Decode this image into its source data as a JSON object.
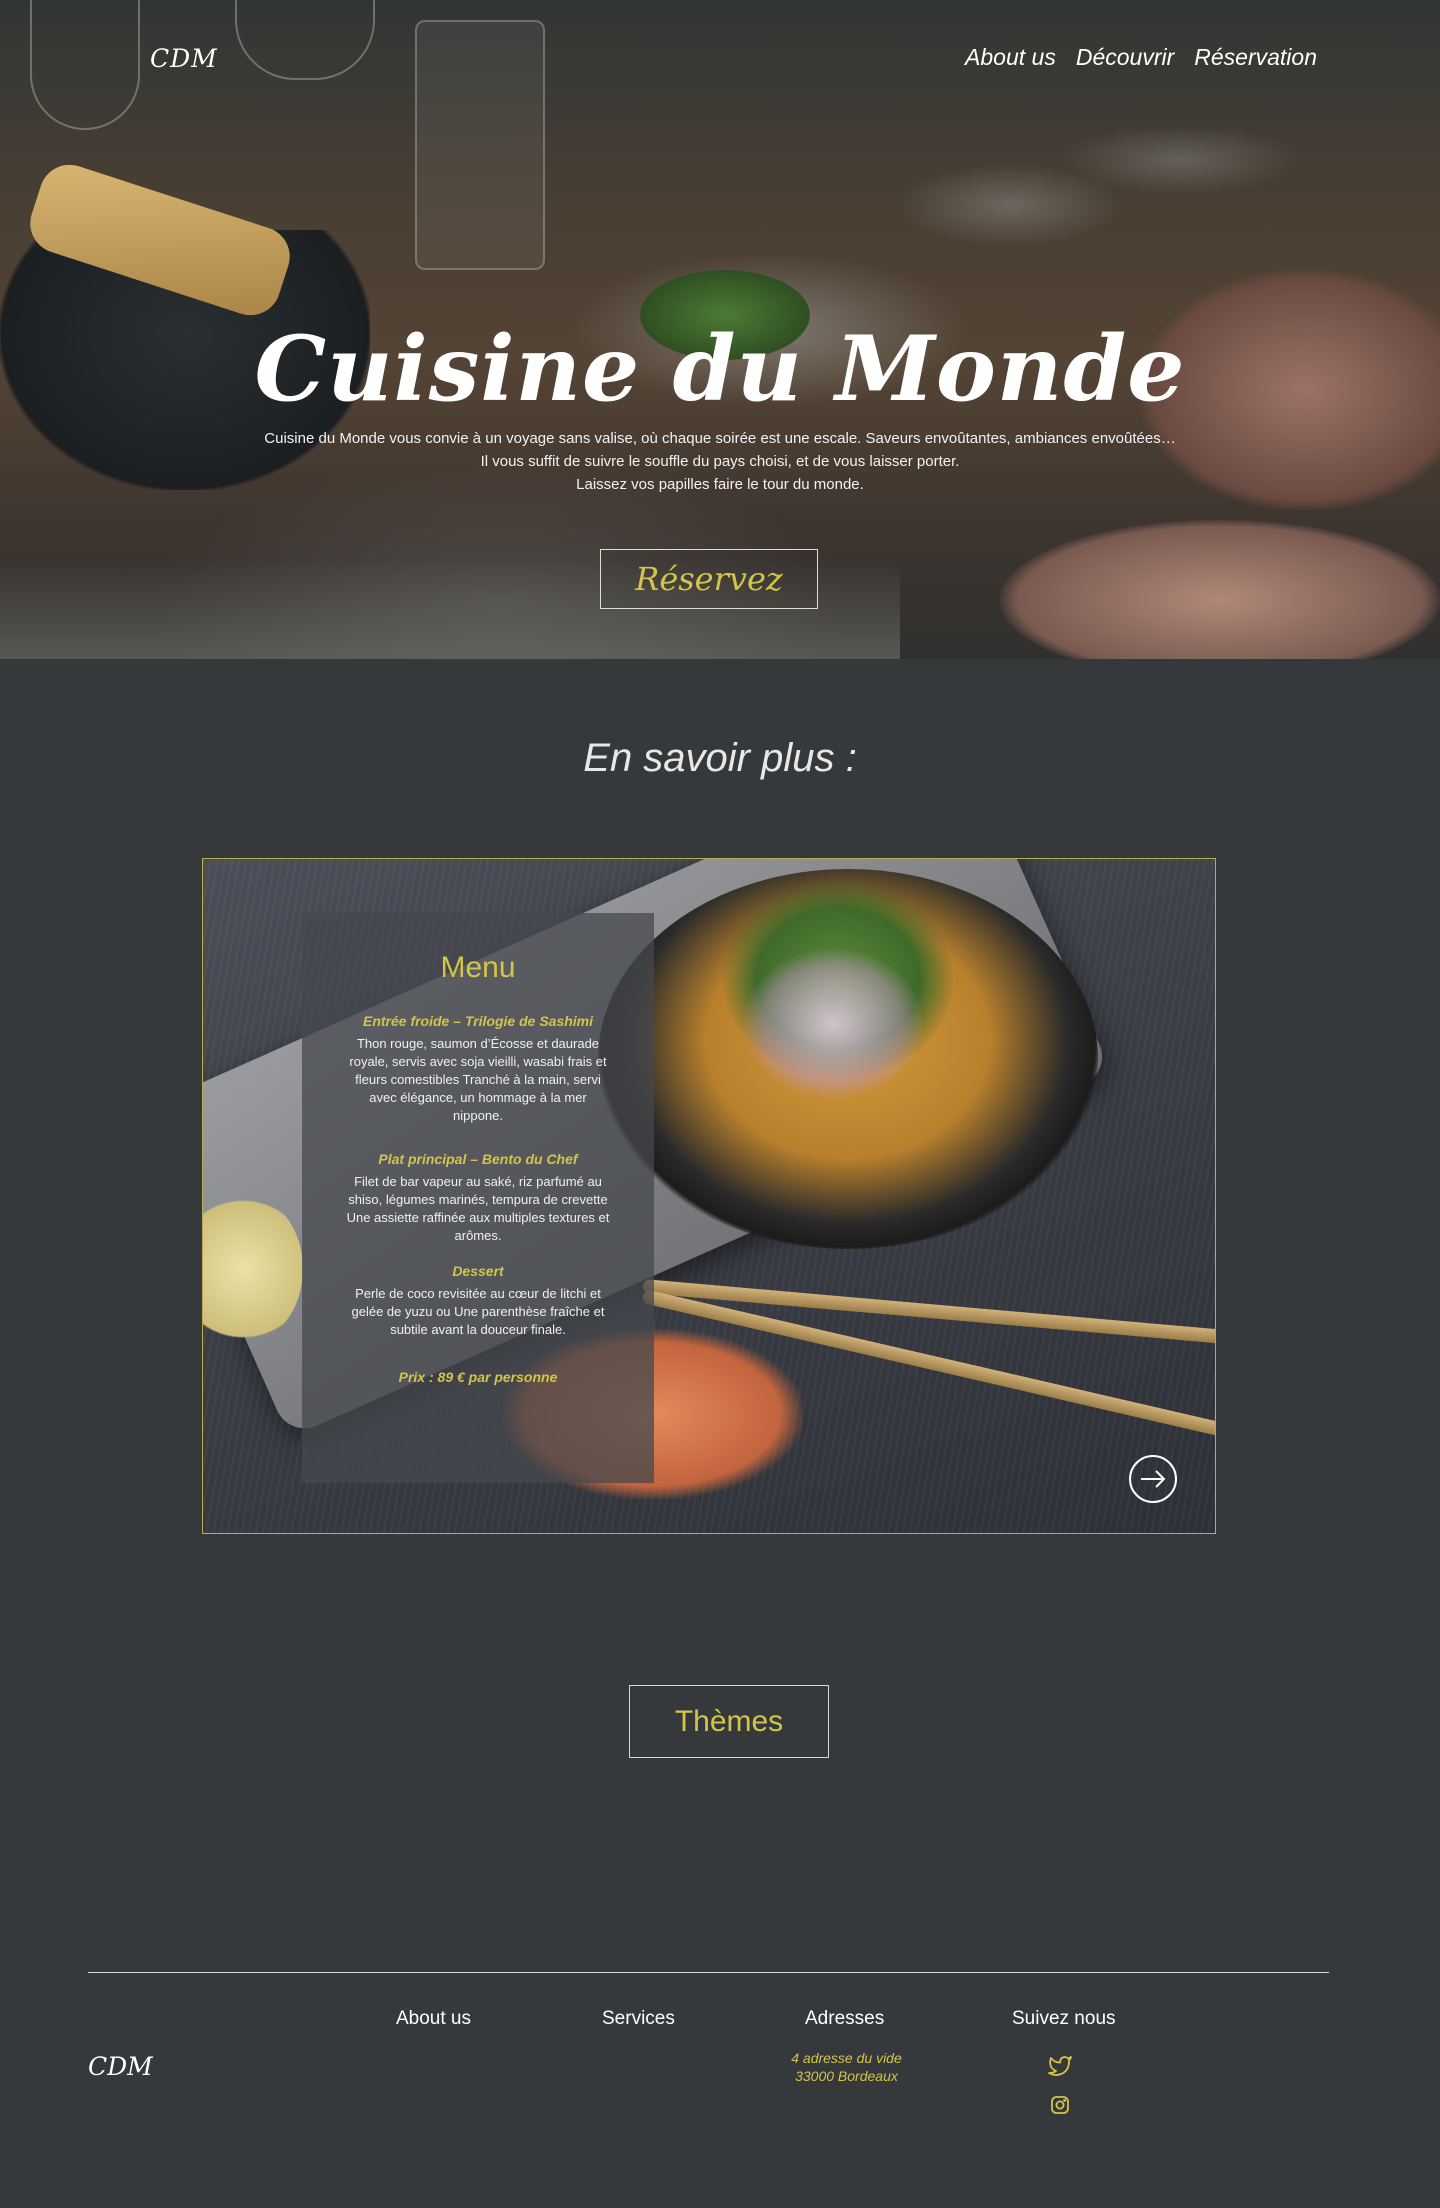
{
  "header": {
    "logo": "CDM",
    "nav": [
      "About us",
      "Découvrir",
      "Réservation"
    ]
  },
  "hero": {
    "title": "Cuisine du Monde",
    "text_lines": [
      "Cuisine du Monde vous convie à un voyage sans valise, où chaque soirée est une escale. Saveurs envoûtantes, ambiances envoûtées…",
      "Il vous suffit de suivre le souffle du pays choisi, et de vous laisser porter.",
      "Laissez vos papilles faire le tour du monde."
    ],
    "cta": "Réservez"
  },
  "savoir": {
    "title": "En savoir plus :"
  },
  "menu": {
    "title": "Menu",
    "sections": [
      {
        "heading": "Entrée froide – Trilogie de Sashimi",
        "text": "Thon rouge, saumon d’Écosse et daurade royale, servis avec soja vieilli, wasabi frais et fleurs comestibles Tranché à la main, servi avec élégance, un hommage à la mer nippone."
      },
      {
        "heading": "Plat principal – Bento du Chef",
        "text": "Filet de bar vapeur au saké, riz parfumé au shiso, légumes marinés, tempura de crevette Une assiette raffinée aux multiples textures et arômes."
      },
      {
        "heading": "Dessert",
        "text": "Perle de coco revisitée au cœur de litchi et gelée de yuzu ou Une parenthèse fraîche et subtile avant la douceur finale."
      }
    ],
    "price": "Prix : 89 € par personne",
    "next_icon": "arrow-right-circle-icon"
  },
  "themes": {
    "label": "Thèmes"
  },
  "footer": {
    "logo": "CDM",
    "columns": [
      "About us",
      "Services",
      "Adresses",
      "Suivez nous"
    ],
    "address_lines": [
      "4 adresse du vide",
      "33000 Bordeaux"
    ],
    "social_icons": [
      "twitter-icon",
      "instagram-icon"
    ]
  },
  "colors": {
    "background": "#36393c",
    "accent": "#d4c449",
    "text": "#ffffff"
  }
}
